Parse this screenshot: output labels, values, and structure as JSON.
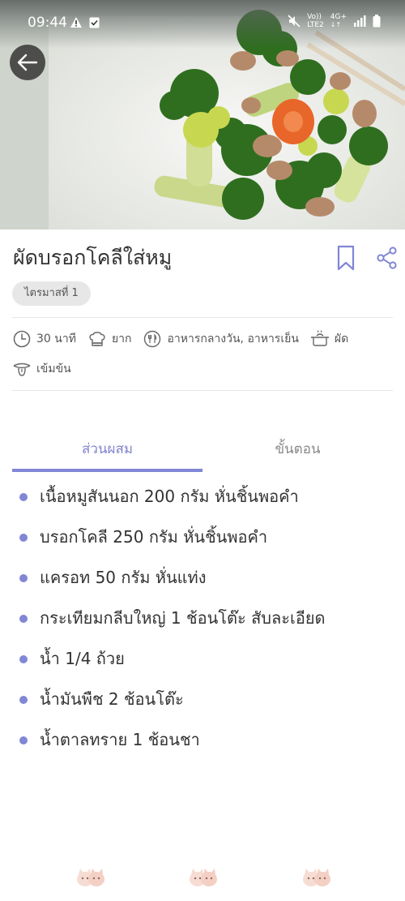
{
  "status_bar": {
    "time": "09:44",
    "network_top": "Vo))",
    "network_bottom": "LTE2",
    "signal_label": "4G+"
  },
  "recipe": {
    "title": "ผัดบรอกโคลีใส่หมู",
    "trimester_tag": "ไตรมาสที่ 1"
  },
  "meta": {
    "time": "30 นาที",
    "difficulty": "ยาก",
    "meal": "อาหารกลางวัน, อาหารเย็น",
    "method": "ผัด",
    "taste": "เข้มข้น"
  },
  "tabs": [
    {
      "label": "ส่วนผสม",
      "active": true
    },
    {
      "label": "ขั้นตอน",
      "active": false
    }
  ],
  "ingredients": [
    "เนื้อหมูสันนอก 200 กรัม หั่นชิ้นพอคำ",
    "บรอกโคลี 250 กรัม หั่นชิ้นพอคำ",
    "แครอท 50 กรัม หั่นแท่ง",
    "กระเทียมกลีบใหญ่ 1 ช้อนโต๊ะ สับละเอียด",
    "น้ำ 1/4 ถ้วย",
    "น้ำมันพืช 2 ช้อนโต๊ะ",
    "น้ำตาลทราย 1 ช้อนชา"
  ],
  "colors": {
    "accent": "#8186d5",
    "tag_bg": "#e7e7e7",
    "text": "#333333"
  },
  "icons": {
    "back": "arrow-left-icon",
    "bookmark": "bookmark-icon",
    "share": "share-icon",
    "clock": "clock-icon",
    "chef": "chef-hat-icon",
    "meal": "fork-knife-icon",
    "pot": "pot-icon",
    "taste": "tongue-icon"
  }
}
